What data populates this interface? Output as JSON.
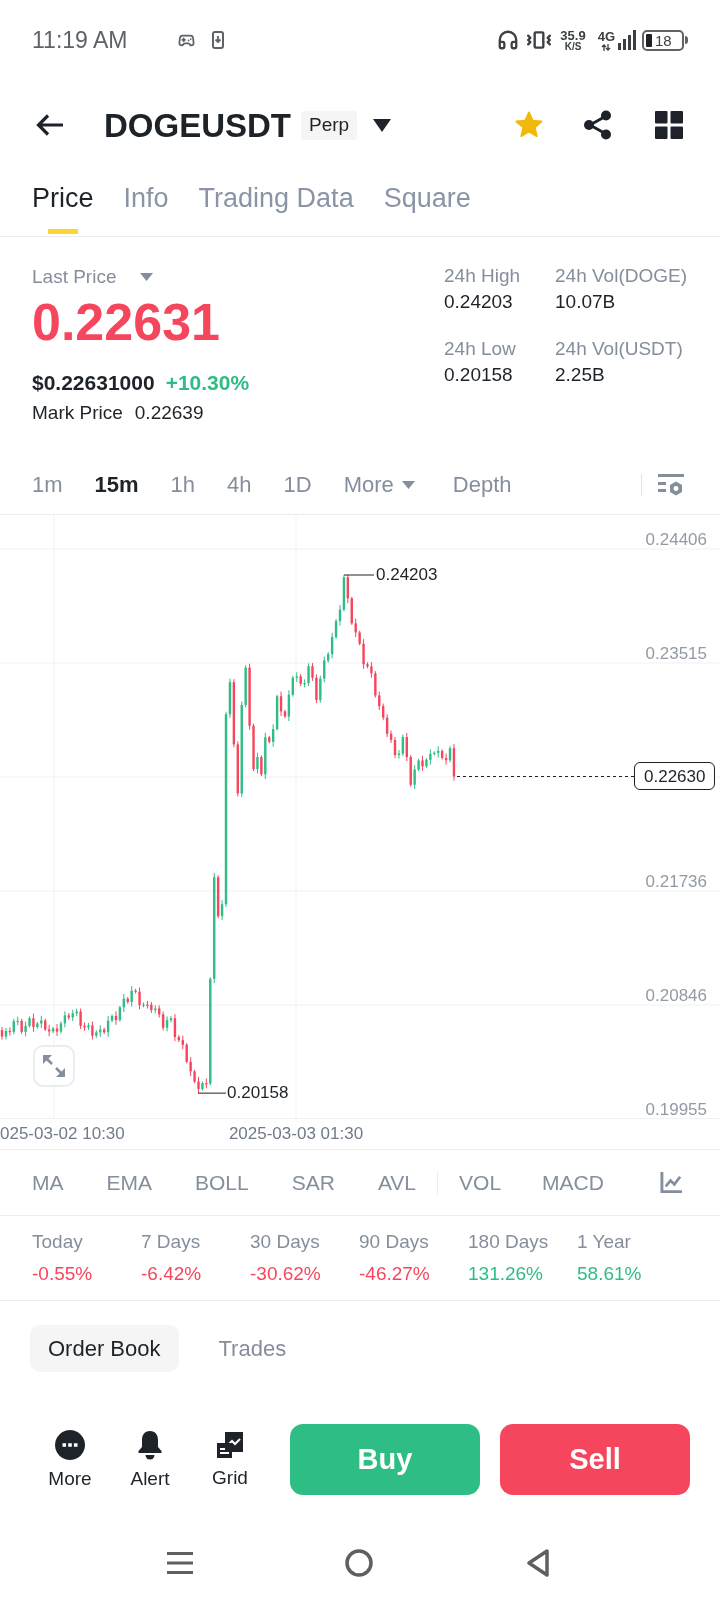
{
  "status_bar": {
    "time": "11:19 AM",
    "network_speed": "35.9",
    "network_speed_unit": "K/S",
    "network_type": "4G",
    "battery": "18"
  },
  "header": {
    "symbol": "DOGEUSDT",
    "contract_type": "Perp",
    "favorite": true
  },
  "tabs": [
    {
      "label": "Price",
      "selected": true
    },
    {
      "label": "Info",
      "selected": false
    },
    {
      "label": "Trading Data",
      "selected": false
    },
    {
      "label": "Square",
      "selected": false
    }
  ],
  "ticker": {
    "last_price_label": "Last Price",
    "last_price": "0.22631",
    "last_price_positive": false,
    "usd_price": "$0.22631000",
    "change": "+10.30%",
    "change_positive": true,
    "mark_price_label": "Mark Price",
    "mark_price": "0.22639"
  },
  "stats": [
    {
      "label": "24h High",
      "value": "0.24203"
    },
    {
      "label": "24h Vol(DOGE)",
      "value": "10.07B"
    },
    {
      "label": "24h Low",
      "value": "0.20158"
    },
    {
      "label": "24h Vol(USDT)",
      "value": "2.25B"
    }
  ],
  "intervals": [
    {
      "label": "1m",
      "kind": "interval",
      "selected": false
    },
    {
      "label": "15m",
      "kind": "interval",
      "selected": true
    },
    {
      "label": "1h",
      "kind": "interval",
      "selected": false
    },
    {
      "label": "4h",
      "kind": "interval",
      "selected": false
    },
    {
      "label": "1D",
      "kind": "interval",
      "selected": false
    },
    {
      "label": "More",
      "kind": "menu",
      "selected": false
    },
    {
      "label": "Depth",
      "kind": "view",
      "selected": false
    }
  ],
  "chart": {
    "y_axis_labels": [
      "0.24406",
      "0.23515",
      "0.21736",
      "0.20846",
      "0.19955"
    ],
    "x_axis_labels": [
      "025-03-02 10:30",
      "2025-03-03 01:30"
    ],
    "high_label": "0.24203",
    "low_label": "0.20158",
    "current_price": "0.22630"
  },
  "main_indicators": [
    "MA",
    "EMA",
    "BOLL",
    "SAR",
    "AVL"
  ],
  "sub_indicators": [
    "VOL",
    "MACD"
  ],
  "performance": [
    {
      "period": "Today",
      "change": "-0.55%",
      "positive": false
    },
    {
      "period": "7 Days",
      "change": "-6.42%",
      "positive": false
    },
    {
      "period": "30 Days",
      "change": "-30.62%",
      "positive": false
    },
    {
      "period": "90 Days",
      "change": "-46.27%",
      "positive": false
    },
    {
      "period": "180 Days",
      "change": "131.26%",
      "positive": true
    },
    {
      "period": "1 Year",
      "change": "58.61%",
      "positive": true
    }
  ],
  "book_tabs": [
    {
      "label": "Order Book",
      "selected": true
    },
    {
      "label": "Trades",
      "selected": false
    }
  ],
  "actions": [
    {
      "label": "More",
      "kind": "more"
    },
    {
      "label": "Alert",
      "kind": "alert"
    },
    {
      "label": "Grid",
      "kind": "grid"
    }
  ],
  "trade_buttons": [
    {
      "label": "Buy",
      "kind": "buy"
    },
    {
      "label": "Sell",
      "kind": "sell"
    }
  ]
}
